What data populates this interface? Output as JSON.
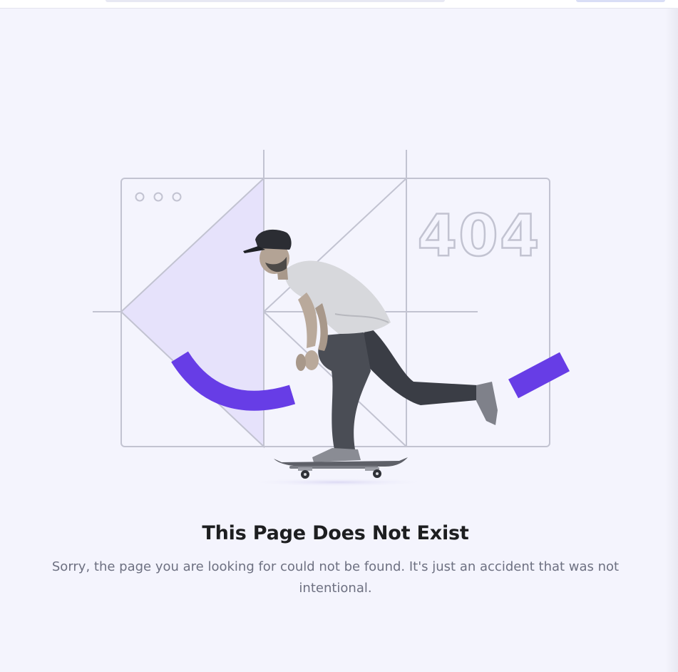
{
  "error": {
    "code": "404",
    "title": "This Page Does Not Exist",
    "message": "Sorry, the page you are looking for could not be found. It's just an accident that was not intentional."
  },
  "illustration": {
    "subject": "skateboarder",
    "accent_color": "#673de6",
    "panel_color": "#e6e2fb",
    "line_color": "#c2c3d1"
  },
  "colors": {
    "background": "#f4f4fd",
    "title": "#1d1e20",
    "message": "#6d7081"
  }
}
